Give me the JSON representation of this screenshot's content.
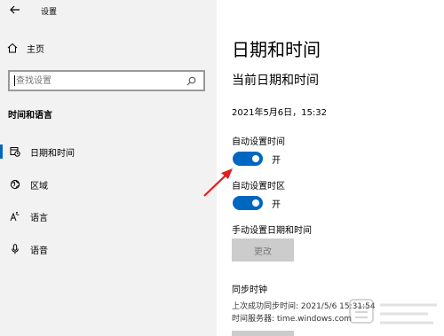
{
  "window": {
    "title": "设置"
  },
  "sidebar": {
    "home_label": "主页",
    "search_placeholder": "查找设置",
    "section_title": "时间和语言",
    "items": [
      {
        "label": "日期和时间",
        "icon": "calendar-clock-icon",
        "active": true
      },
      {
        "label": "区域",
        "icon": "globe-icon",
        "active": false
      },
      {
        "label": "语言",
        "icon": "language-icon",
        "active": false
      },
      {
        "label": "语音",
        "icon": "microphone-icon",
        "active": false
      }
    ]
  },
  "main": {
    "page_title": "日期和时间",
    "subtitle": "当前日期和时间",
    "current_datetime": "2021年5月6日，15:32",
    "auto_time": {
      "label": "自动设置时间",
      "state": "开",
      "on": true
    },
    "auto_timezone": {
      "label": "自动设置时区",
      "state": "开",
      "on": true
    },
    "manual": {
      "label": "手动设置日期和时间",
      "button_label": "更改"
    },
    "sync": {
      "title": "同步时钟",
      "last_sync": "上次成功同步时间: 2021/5/6 15:31:54",
      "server": "时间服务器: time.windows.com"
    }
  },
  "colors": {
    "accent": "#0067c0",
    "annotation_arrow": "#e02020",
    "sidebar_bg": "#f2f2f2"
  }
}
